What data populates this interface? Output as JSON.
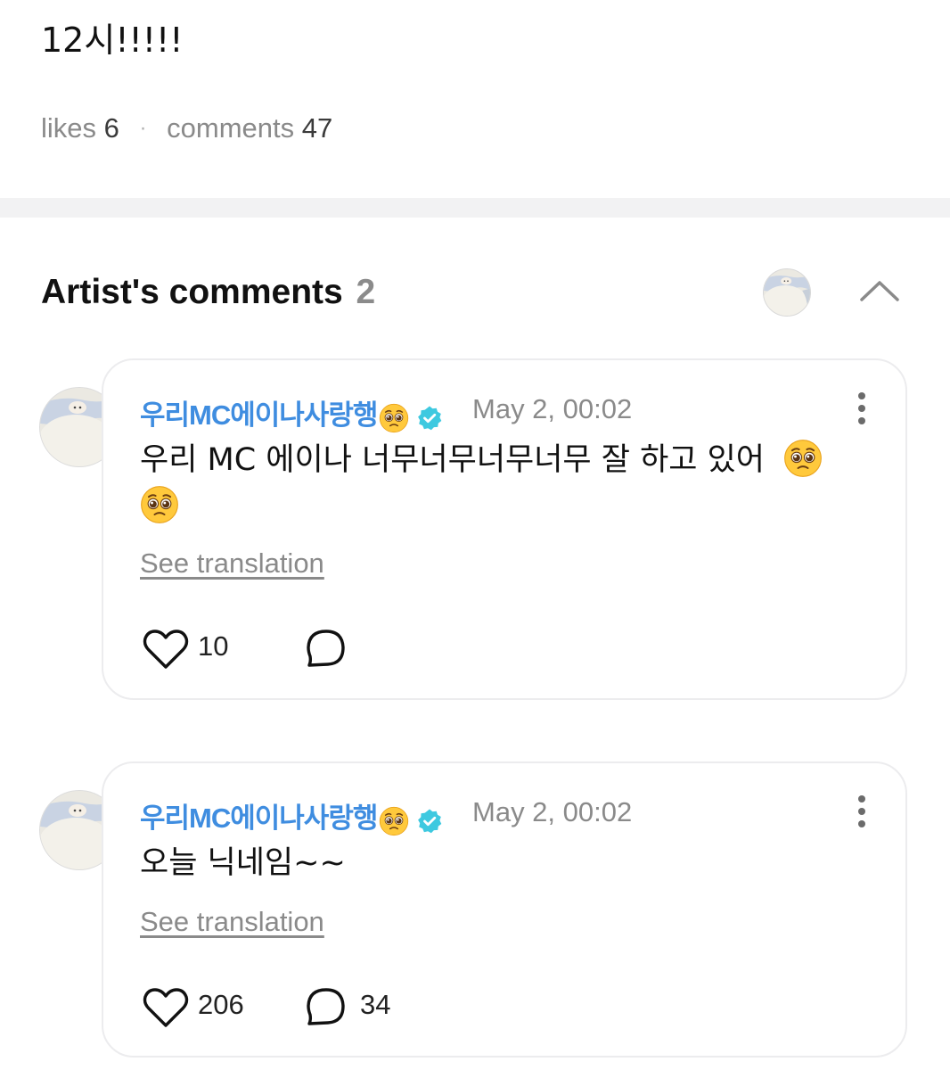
{
  "post": {
    "text": "12시!!!!!"
  },
  "stats": {
    "likes_label": "likes",
    "likes": "6",
    "separator": "·",
    "comments_label": "comments",
    "comments": "47"
  },
  "artist_section": {
    "title": "Artist's comments",
    "count": "2"
  },
  "comments": [
    {
      "author": "우리MC에이나사랑행",
      "author_emoji": "pleading-face",
      "verified_icon": "verified-badge-icon",
      "date": "May 2, 00:02",
      "text": "우리 MC 에이나 너무너무너무너무 잘 하고 있어",
      "text_emojis": [
        "pleading-face",
        "pleading-face"
      ],
      "see_translation": "See translation",
      "likes": "10",
      "replies": ""
    },
    {
      "author": "우리MC에이나사랑행",
      "author_emoji": "pleading-face",
      "verified_icon": "verified-badge-icon",
      "date": "May 2, 00:02",
      "text": "오늘 닉네임~~",
      "see_translation": "See translation",
      "likes": "206",
      "replies": "34"
    }
  ],
  "colors": {
    "author": "#3f8de0",
    "verified": "#3ec9e0",
    "muted": "#8a8a8a",
    "divider": "#f2f2f3"
  }
}
